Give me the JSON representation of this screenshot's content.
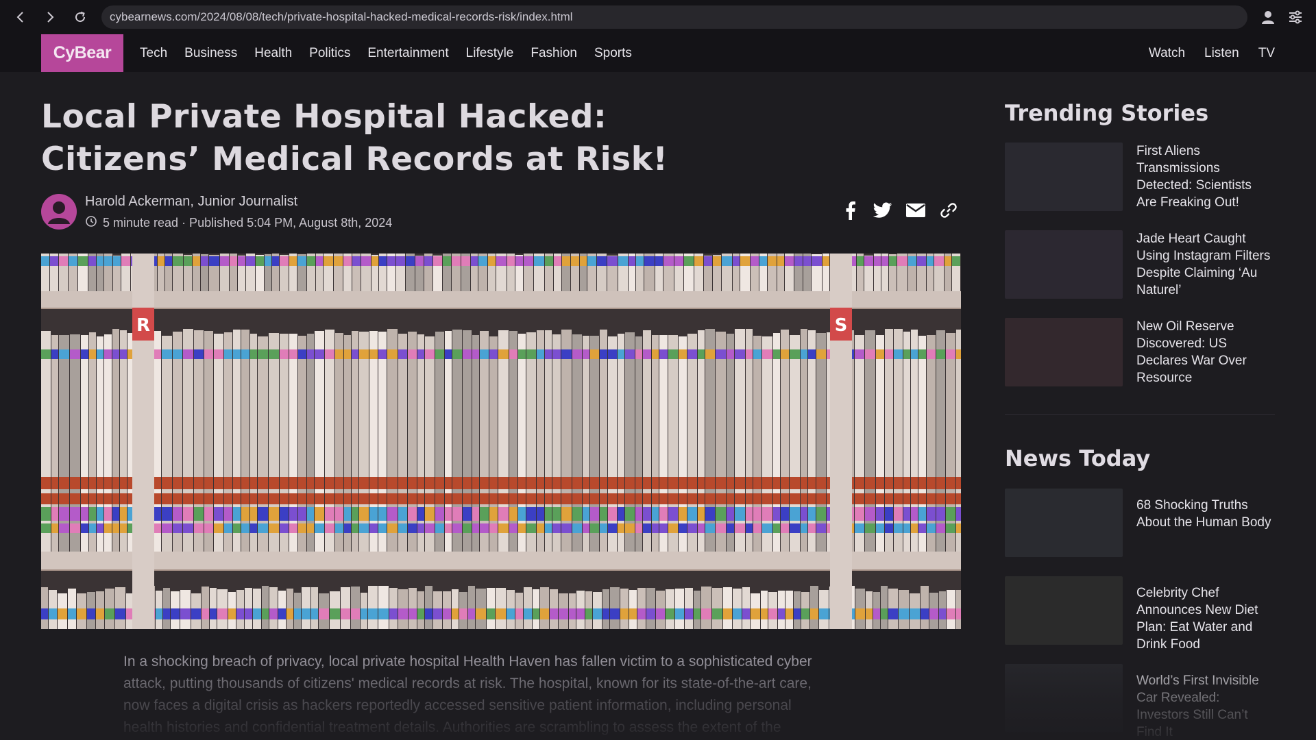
{
  "browser": {
    "url": "cybearnews.com/2024/08/08/tech/private-hospital-hacked-medical-records-risk/index.html"
  },
  "site": {
    "logo": "CyBear",
    "nav": [
      "Tech",
      "Business",
      "Health",
      "Politics",
      "Entertainment",
      "Lifestyle",
      "Fashion",
      "Sports"
    ],
    "right_nav": [
      "Watch",
      "Listen",
      "TV"
    ],
    "brand_color": "#b6479a"
  },
  "article": {
    "title_line1": "Local Private Hospital Hacked:",
    "title_line2": "Citizens’ Medical Records at Risk!",
    "author": "Harold Ackerman, Junior Journalist",
    "meta": "5 minute read · Published 5:04 PM, August 8th, 2024",
    "share_icons": [
      "facebook-icon",
      "twitter-icon",
      "email-icon",
      "link-icon"
    ],
    "hero_labels": [
      "R",
      "S"
    ],
    "body_lines": [
      "In a shocking breach of privacy, local private hospital Health Haven has fallen victim to a sophisticated cyber",
      "attack, putting thousands of citizens' medical records at risk. The hospital, known for its state-of-the-art care,",
      "now faces a digital crisis as hackers reportedly accessed sensitive patient information, including personal",
      "health histories and confidential treatment details. Authorities are scrambling to assess the extent of the"
    ]
  },
  "sidebar": {
    "trending_heading": "Trending Stories",
    "trending": [
      {
        "title": "First Aliens Transmissions Detected: Scientists Are Freaking Out!",
        "thumb_color": "#2a2930"
      },
      {
        "title": "Jade Heart Caught Using Instagram Filters Despite Claiming ‘Au Naturel’",
        "thumb_color": "#2c2831"
      },
      {
        "title": "New Oil Reserve Discovered: US Declares War Over Resource",
        "thumb_color": "#33282d"
      }
    ],
    "news_heading": "News Today",
    "news": [
      {
        "title": "68 Shocking Truths About the Human Body",
        "thumb_color": "#2a2b30"
      },
      {
        "title": "Celebrity Chef Announces New Diet Plan: Eat Water and Drink Food",
        "thumb_color": "#2b2b2b"
      },
      {
        "title": "World’s First Invisible Car Revealed: Investors Still Can’t Find It",
        "thumb_color": "#27272c"
      }
    ]
  }
}
